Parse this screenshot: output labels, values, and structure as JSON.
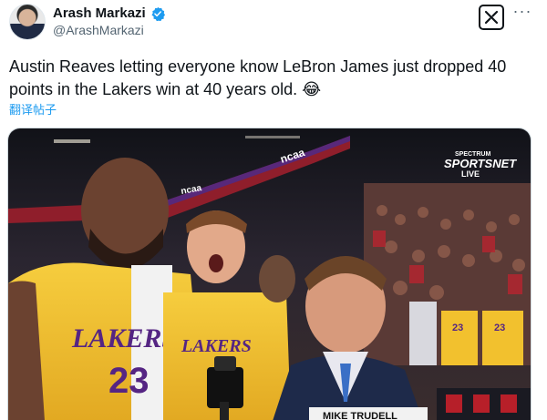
{
  "author": {
    "display_name": "Arash Markazi",
    "handle": "@ArashMarkazi",
    "verified_icon": "verified-badge-icon"
  },
  "header_actions": {
    "grok_icon": "grok-icon",
    "more_icon": "more-icon",
    "more_label": "···"
  },
  "tweet": {
    "text": "Austin Reaves letting everyone know LeBron James just dropped 40 points in the Lakers win at 40 years old. 😂",
    "translate_label": "翻译帖子"
  },
  "media": {
    "broadcaster_top": "SPECTRUM",
    "broadcaster_main": "SPORTSNET",
    "broadcaster_sub": "LIVE",
    "jersey_text_left": "LAKERS",
    "jersey_number_left": "23",
    "jersey_text_center": "LAKERS",
    "lower_third_text": "MIKE TRUDELL",
    "arena_sign": "ncaa",
    "fan_jersey_number": "23",
    "colors": {
      "lakers_gold": "#f2c12e",
      "lakers_purple": "#552583",
      "arena_dark": "#1c1c22",
      "crowd_red": "#a6262e"
    }
  }
}
